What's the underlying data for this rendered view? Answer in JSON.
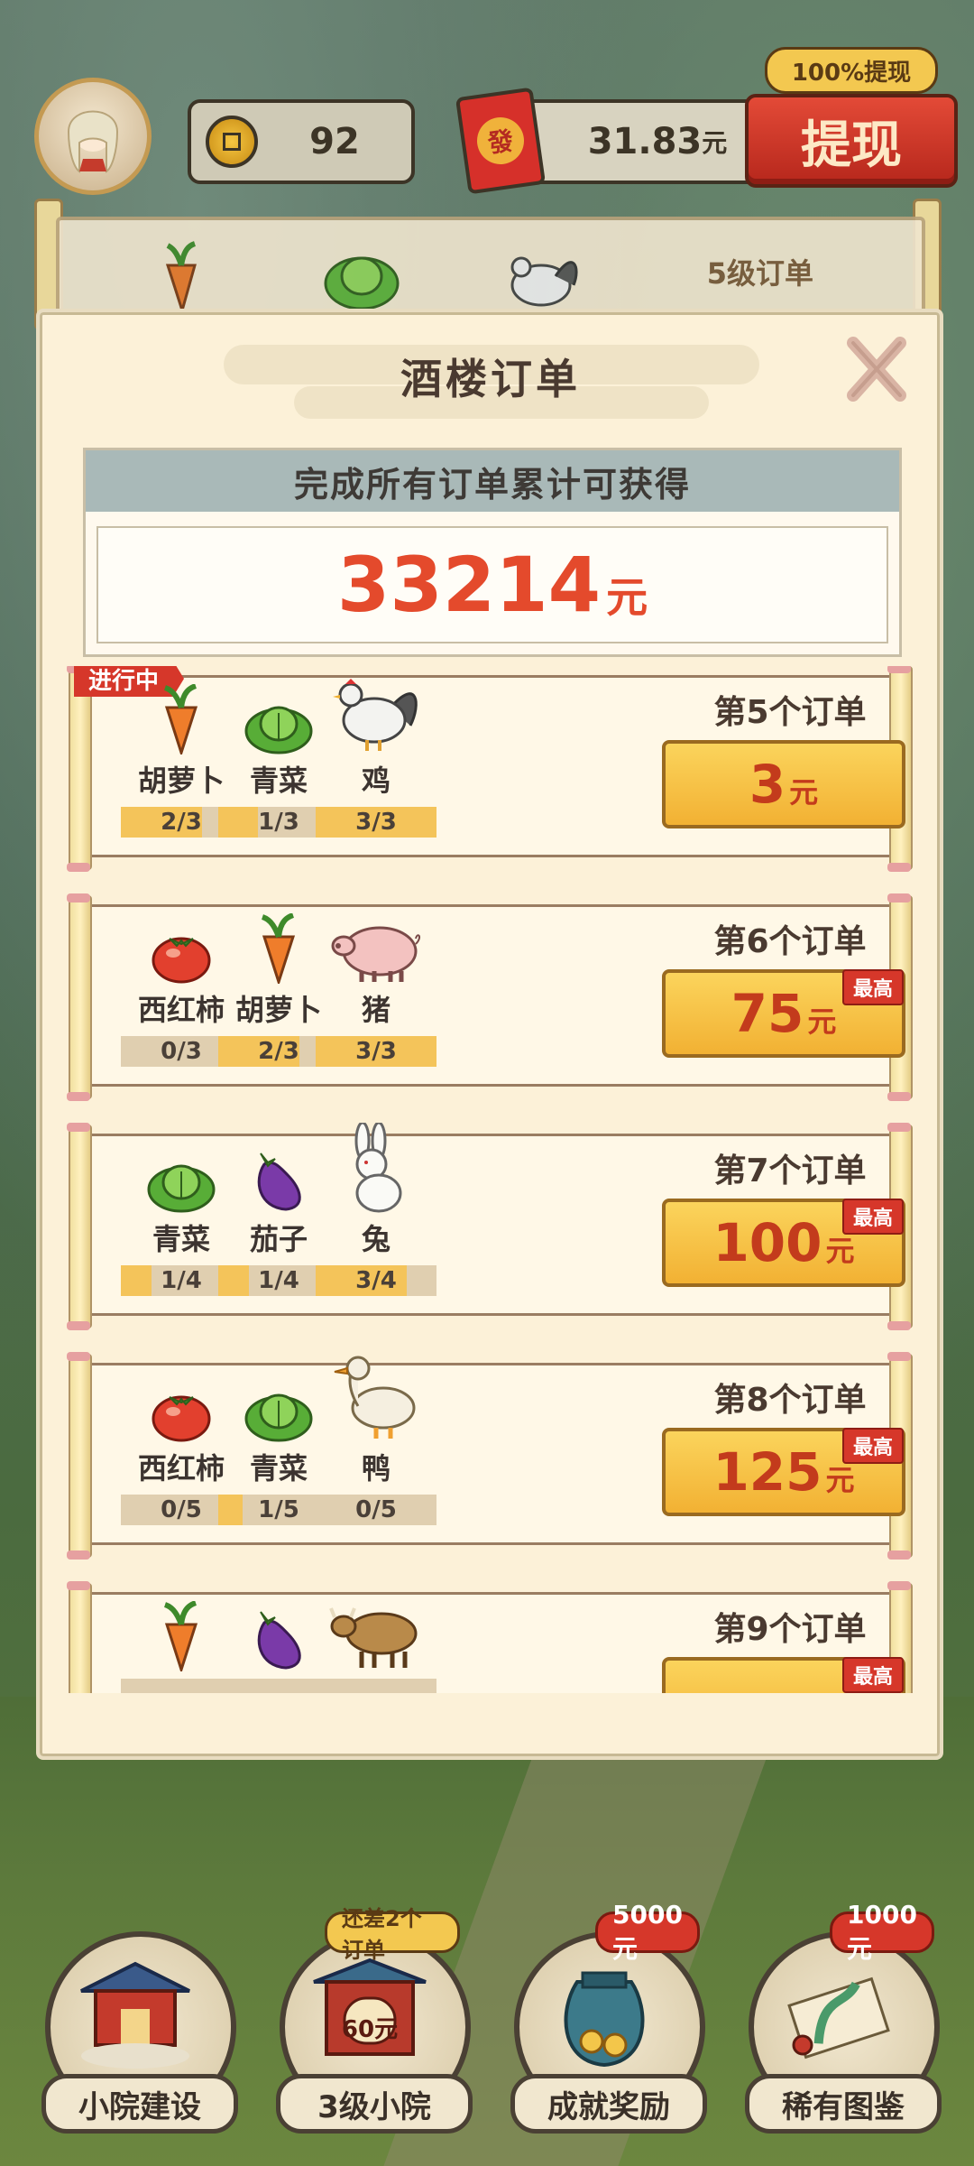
{
  "top_bar": {
    "coins": "92",
    "money_value": "31.83",
    "money_unit": "元",
    "redpack_char": "發",
    "withdraw_label": "提现",
    "withdraw_tip": "100%提现"
  },
  "background_strip": {
    "level_label": "5级订单"
  },
  "modal": {
    "title": "酒楼订单",
    "total_header": "完成所有订单累计可获得",
    "total_value": "33214",
    "total_unit": "元"
  },
  "orders": [
    {
      "title": "第5个订单",
      "reward": "3",
      "unit": "元",
      "in_progress": "进行中",
      "badge": "",
      "items": [
        {
          "name": "胡萝卜",
          "progress": "2/3",
          "fill": 0.67,
          "icon": "carrot-icon"
        },
        {
          "name": "青菜",
          "progress": "1/3",
          "fill": 0.33,
          "icon": "cabbage-icon"
        },
        {
          "name": "鸡",
          "progress": "3/3",
          "fill": 1.0,
          "icon": "chicken-icon"
        }
      ]
    },
    {
      "title": "第6个订单",
      "reward": "75",
      "unit": "元",
      "badge": "最高",
      "items": [
        {
          "name": "西红柿",
          "progress": "0/3",
          "fill": 0.0,
          "icon": "tomato-icon"
        },
        {
          "name": "胡萝卜",
          "progress": "2/3",
          "fill": 0.67,
          "icon": "carrot-icon"
        },
        {
          "name": "猪",
          "progress": "3/3",
          "fill": 1.0,
          "icon": "pig-icon"
        }
      ]
    },
    {
      "title": "第7个订单",
      "reward": "100",
      "unit": "元",
      "badge": "最高",
      "items": [
        {
          "name": "青菜",
          "progress": "1/4",
          "fill": 0.25,
          "icon": "cabbage-icon"
        },
        {
          "name": "茄子",
          "progress": "1/4",
          "fill": 0.25,
          "icon": "eggplant-icon"
        },
        {
          "name": "兔",
          "progress": "3/4",
          "fill": 0.75,
          "icon": "rabbit-icon"
        }
      ]
    },
    {
      "title": "第8个订单",
      "reward": "125",
      "unit": "元",
      "badge": "最高",
      "items": [
        {
          "name": "西红柿",
          "progress": "0/5",
          "fill": 0.0,
          "icon": "tomato-icon"
        },
        {
          "name": "青菜",
          "progress": "1/5",
          "fill": 0.2,
          "icon": "cabbage-icon"
        },
        {
          "name": "鸭",
          "progress": "0/5",
          "fill": 0.0,
          "icon": "duck-icon"
        }
      ]
    },
    {
      "title": "第9个订单",
      "reward": "",
      "unit": "",
      "badge": "最高",
      "items": [
        {
          "name": "",
          "progress": "",
          "fill": 0.0,
          "icon": "carrot-icon"
        },
        {
          "name": "",
          "progress": "",
          "fill": 0.0,
          "icon": "eggplant-icon"
        },
        {
          "name": "",
          "progress": "",
          "fill": 0.0,
          "icon": "cow-icon"
        }
      ]
    }
  ],
  "bottom_nav": [
    {
      "label": "小院建设",
      "badge": "",
      "badge_style": "",
      "icon": "pavilion-icon"
    },
    {
      "label": "3级小院",
      "badge": "还差2个订单",
      "badge_style": "yel",
      "icon": "gate-icon",
      "art_text": "60元"
    },
    {
      "label": "成就奖励",
      "badge": "5000元",
      "badge_style": "red",
      "icon": "treasure-bag-icon"
    },
    {
      "label": "稀有图鉴",
      "badge": "1000元",
      "badge_style": "red",
      "icon": "scroll-icon"
    }
  ],
  "colors": {
    "accent_red": "#e44a2c",
    "reward_gold": "#f2b133",
    "paper": "#fcf1d8"
  }
}
